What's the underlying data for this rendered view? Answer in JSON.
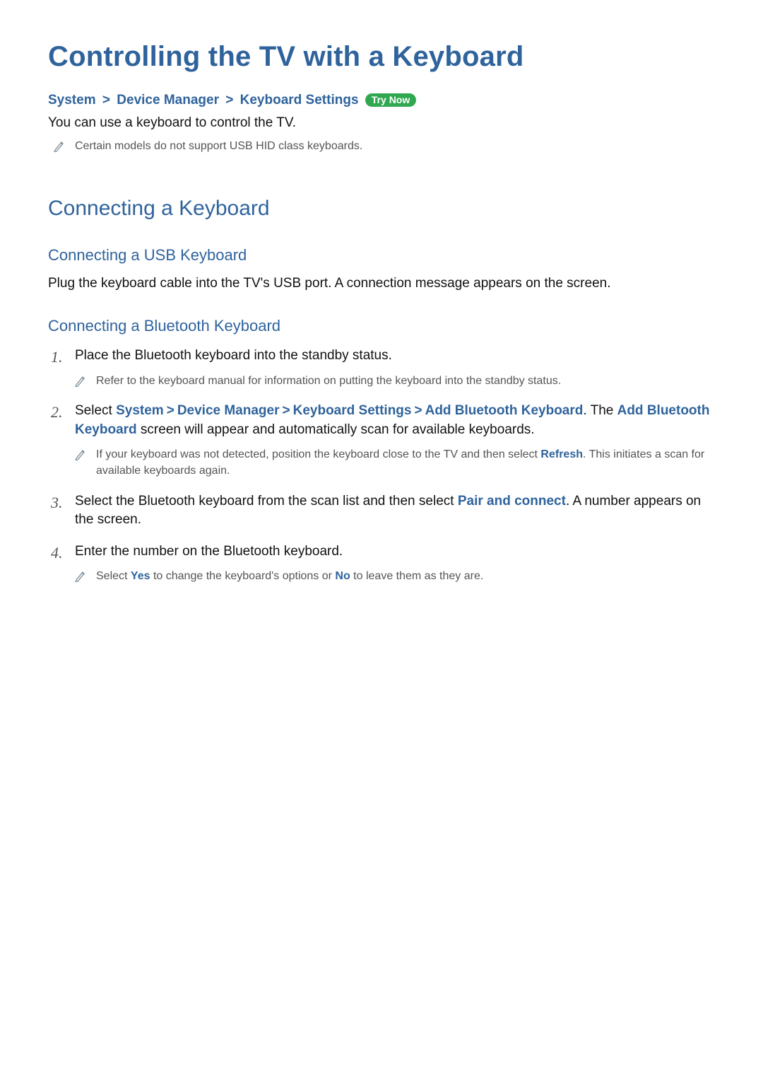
{
  "title": "Controlling the TV with a Keyboard",
  "breadcrumb": {
    "items": [
      "System",
      "Device Manager",
      "Keyboard Settings"
    ],
    "sep": ">",
    "try_now": "Try Now"
  },
  "intro": "You can use a keyboard to control the TV.",
  "intro_note": "Certain models do not support USB HID class keyboards.",
  "section_connecting": "Connecting a Keyboard",
  "usb": {
    "heading": "Connecting a USB Keyboard",
    "body": "Plug the keyboard cable into the TV's USB port. A connection message appears on the screen."
  },
  "bt": {
    "heading": "Connecting a Bluetooth Keyboard",
    "steps": [
      {
        "text": "Place the Bluetooth keyboard into the standby status.",
        "note": "Refer to the keyboard manual for information on putting the keyboard into the standby status."
      },
      {
        "prefix": "Select ",
        "path": [
          "System",
          "Device Manager",
          "Keyboard Settings",
          "Add Bluetooth Keyboard"
        ],
        "sep": ">",
        "mid": ". The ",
        "highlight": "Add Bluetooth Keyboard",
        "suffix": " screen will appear and automatically scan for available keyboards.",
        "note_pre": "If your keyboard was not detected, position the keyboard close to the TV and then select ",
        "note_hl": "Refresh",
        "note_post": ". This initiates a scan for available keyboards again."
      },
      {
        "pre": "Select the Bluetooth keyboard from the scan list and then select ",
        "hl": "Pair and connect",
        "post": ". A number appears on the screen."
      },
      {
        "text": "Enter the number on the Bluetooth keyboard.",
        "note_pre": "Select ",
        "note_hl1": "Yes",
        "note_mid": " to change the keyboard's options or ",
        "note_hl2": "No",
        "note_post": " to leave them as they are."
      }
    ]
  }
}
